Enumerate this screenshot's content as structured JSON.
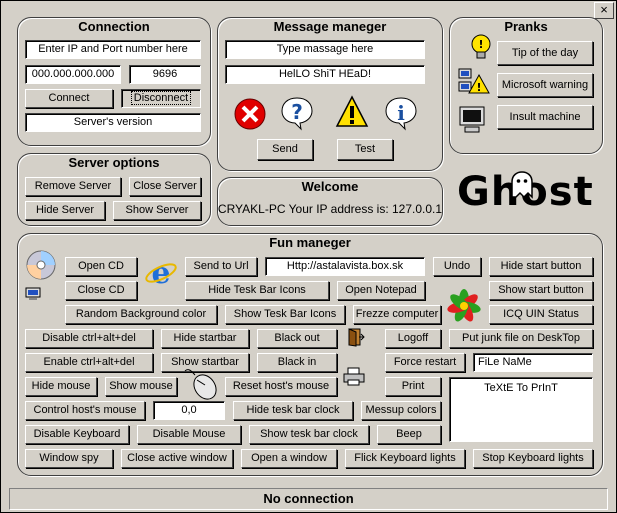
{
  "window": {
    "close_label": "×"
  },
  "connection": {
    "title": "Connection",
    "ip_port_hint": "Enter IP and Port number here",
    "ip_value": "000.000.000.000",
    "port_value": "9696",
    "connect_label": "Connect",
    "disconnect_label": "Disconnect",
    "server_version": "Server's version"
  },
  "message": {
    "title": "Message maneger",
    "type_hint": "Type massage here",
    "message_value": "HelLO ShiT HEaD!",
    "send_label": "Send",
    "test_label": "Test"
  },
  "pranks": {
    "title": "Pranks",
    "tip_label": "Tip of the day",
    "ms_warning_label": "Microsoft warning",
    "insult_label": "Insult machine"
  },
  "server_options": {
    "title": "Server options",
    "remove_label": "Remove Server",
    "close_label": "Close Server",
    "hide_label": "Hide Server",
    "show_label": "Show Server"
  },
  "welcome": {
    "title": "Welcome",
    "text": "CRYAKL-PC Your IP address is: 127.0.0.1"
  },
  "logo": {
    "text": "Ghost"
  },
  "fun": {
    "title": "Fun maneger",
    "open_cd": "Open CD",
    "close_cd": "Close CD",
    "send_to_url": "Send to Url",
    "url_value": "Http://astalavista.box.sk",
    "undo": "Undo",
    "hide_start_button": "Hide start button",
    "show_start_button": "Show start button",
    "hide_taskbar_icons": "Hide Tesk Bar Icons",
    "open_notepad": "Open Notepad",
    "random_bg": "Random Background color",
    "show_taskbar_icons": "Show Tesk Bar Icons",
    "freeze": "Frezze computer",
    "icq_status": "ICQ UIN Status",
    "disable_cad": "Disable ctrl+alt+del",
    "hide_startbar": "Hide startbar",
    "black_out": "Black out",
    "logoff": "Logoff",
    "junk_file": "Put junk file on DeskTop",
    "enable_cad": "Enable ctrl+alt+del",
    "show_startbar": "Show startbar",
    "black_in": "Black in",
    "force_restart": "Force restart",
    "file_name_value": "FiLe NaMe",
    "hide_mouse": "Hide mouse",
    "show_mouse": "Show mouse",
    "reset_mouse": "Reset host's mouse",
    "print": "Print",
    "print_text_value": "TeXtE To PrInT",
    "control_mouse": "Control host's mouse",
    "coords_value": "0,0",
    "hide_clock": "Hide tesk bar clock",
    "messup_colors": "Messup colors",
    "disable_keyboard": "Disable Keyboard",
    "disable_mouse": "Disable Mouse",
    "show_clock": "Show tesk bar clock",
    "beep": "Beep",
    "window_spy": "Window spy",
    "close_active": "Close active window",
    "open_window": "Open a window",
    "flick_lights": "Flick Keyboard lights",
    "stop_lights": "Stop Keyboard lights"
  },
  "status": {
    "text": "No connection"
  }
}
